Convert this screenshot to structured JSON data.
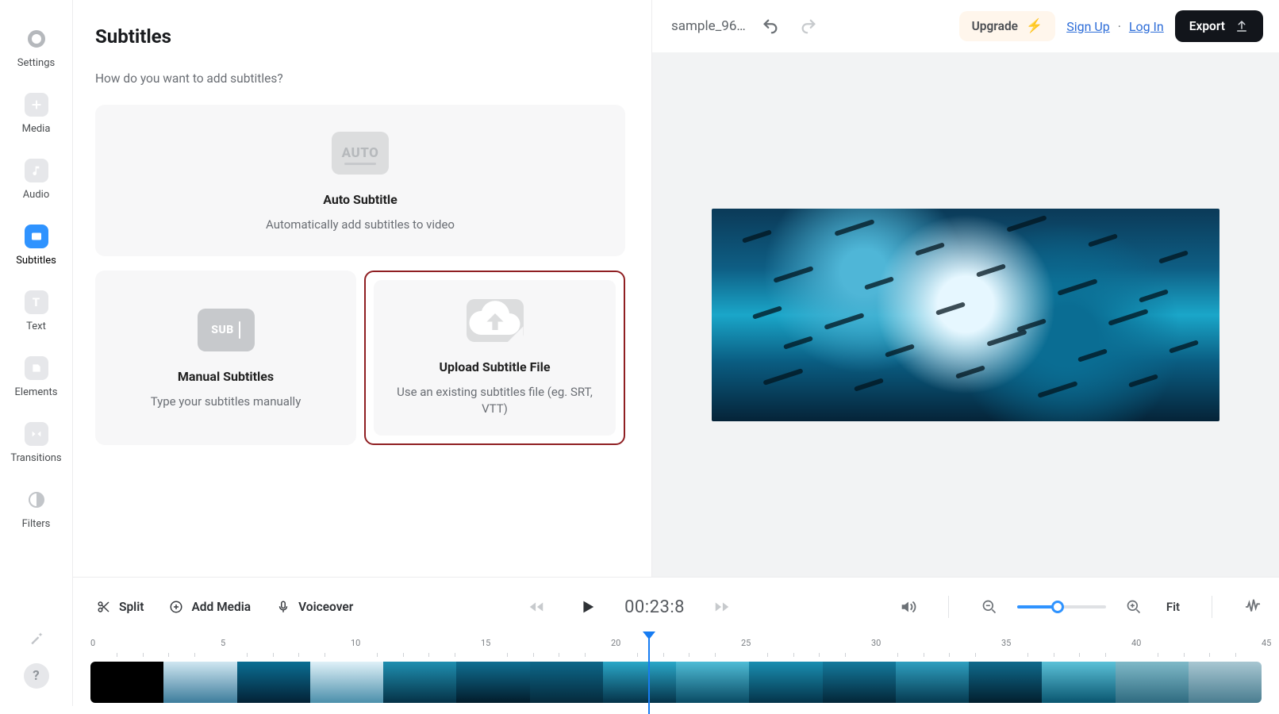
{
  "rail": {
    "items": [
      {
        "key": "settings",
        "label": "Settings"
      },
      {
        "key": "media",
        "label": "Media"
      },
      {
        "key": "audio",
        "label": "Audio"
      },
      {
        "key": "subtitles",
        "label": "Subtitles"
      },
      {
        "key": "text",
        "label": "Text"
      },
      {
        "key": "elements",
        "label": "Elements"
      },
      {
        "key": "transitions",
        "label": "Transitions"
      },
      {
        "key": "filters",
        "label": "Filters"
      }
    ],
    "help": "?"
  },
  "panel": {
    "title": "Subtitles",
    "subtitle": "How do you want to add subtitles?",
    "auto_badge": "AUTO",
    "auto_title": "Auto Subtitle",
    "auto_desc": "Automatically add subtitles to video",
    "manual_badge": "SUB",
    "manual_title": "Manual Subtitles",
    "manual_desc": "Type your subtitles manually",
    "upload_title": "Upload Subtitle File",
    "upload_desc": "Use an existing subtitles file (eg. SRT, VTT)"
  },
  "topbar": {
    "project_name": "sample_96…",
    "upgrade": "Upgrade",
    "sign_up": "Sign Up",
    "separator": "·",
    "log_in": "Log In",
    "export": "Export"
  },
  "transport": {
    "timecode": "00:23:8",
    "fit": "Fit"
  },
  "toolbar": {
    "split": "Split",
    "add_media": "Add Media",
    "voiceover": "Voiceover"
  },
  "ruler": {
    "marks": [
      "0",
      "5",
      "10",
      "15",
      "20",
      "25",
      "30",
      "35",
      "40",
      "45"
    ],
    "playhead_pct": 47.6
  },
  "clips": {
    "gradients": [
      "#000000",
      "linear-gradient(180deg,#cfe6f1,#3d7d9c)",
      "linear-gradient(180deg,#0b6e93,#032236)",
      "linear-gradient(180deg,#dff1f8,#4b8fab)",
      "linear-gradient(180deg,#1f8fb0,#053247)",
      "linear-gradient(180deg,#106f92,#021c2b)",
      "linear-gradient(180deg,#0d6789,#052a3c)",
      "linear-gradient(180deg,#2aa7c8,#053349)",
      "linear-gradient(180deg,#4ebcd6,#0a4b64)",
      "linear-gradient(180deg,#1a8eb1,#04344a)",
      "linear-gradient(180deg,#147a9d,#032638)",
      "linear-gradient(180deg,#2e9fc0,#063a50)",
      "linear-gradient(180deg,#0f6a8c,#021f2e)",
      "linear-gradient(180deg,#5bc1d8,#0a5670)",
      "linear-gradient(180deg,#7fb9c8,#2f6b80)",
      "linear-gradient(180deg,#a8c7d2,#4a7d90)"
    ]
  }
}
